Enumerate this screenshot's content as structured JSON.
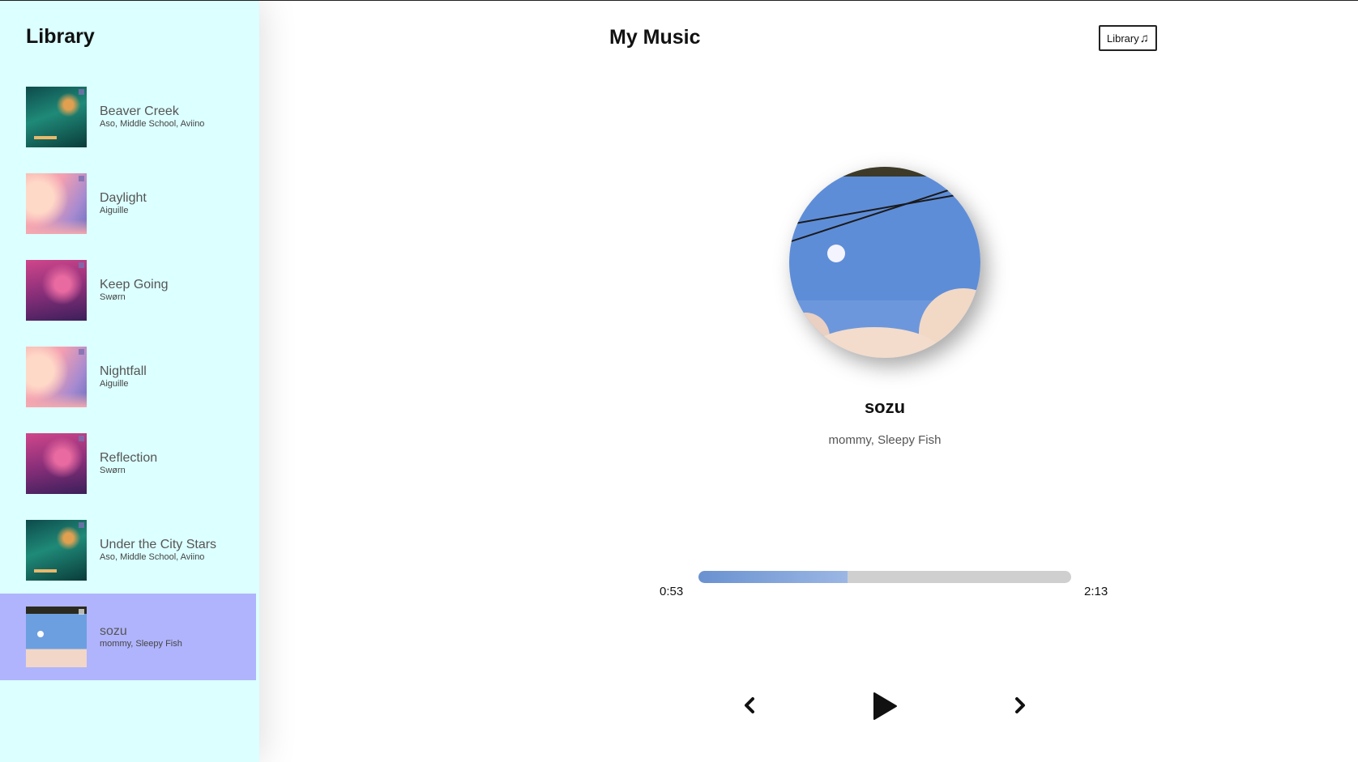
{
  "sidebar": {
    "title": "Library",
    "songs": [
      {
        "title": "Beaver Creek",
        "artist": "Aso, Middle School, Aviino",
        "cover": "forest"
      },
      {
        "title": "Daylight",
        "artist": "Aiguille",
        "cover": "pink"
      },
      {
        "title": "Keep Going",
        "artist": "Swørn",
        "cover": "magenta"
      },
      {
        "title": "Nightfall",
        "artist": "Aiguille",
        "cover": "pink"
      },
      {
        "title": "Reflection",
        "artist": "Swørn",
        "cover": "magenta"
      },
      {
        "title": "Under the City Stars",
        "artist": "Aso, Middle School, Aviino",
        "cover": "forest"
      },
      {
        "title": "sozu",
        "artist": "mommy, Sleepy Fish",
        "cover": "sky",
        "active": true
      }
    ]
  },
  "header": {
    "title": "My Music",
    "library_button": "Library",
    "library_button_icon": "music-note-icon"
  },
  "player": {
    "title": "sozu",
    "artist": "mommy, Sleepy Fish",
    "current_time": "0:53",
    "total_time": "2:13",
    "progress_fraction": 0.4
  },
  "controls": {
    "prev_icon": "chevron-left-icon",
    "play_icon": "play-icon",
    "next_icon": "chevron-right-icon"
  },
  "colors": {
    "sidebar_bg": "#dcffff",
    "active_item_bg": "#b0b4fc",
    "progress_fill": "#6a92d0",
    "progress_track": "#cfcfcf"
  }
}
